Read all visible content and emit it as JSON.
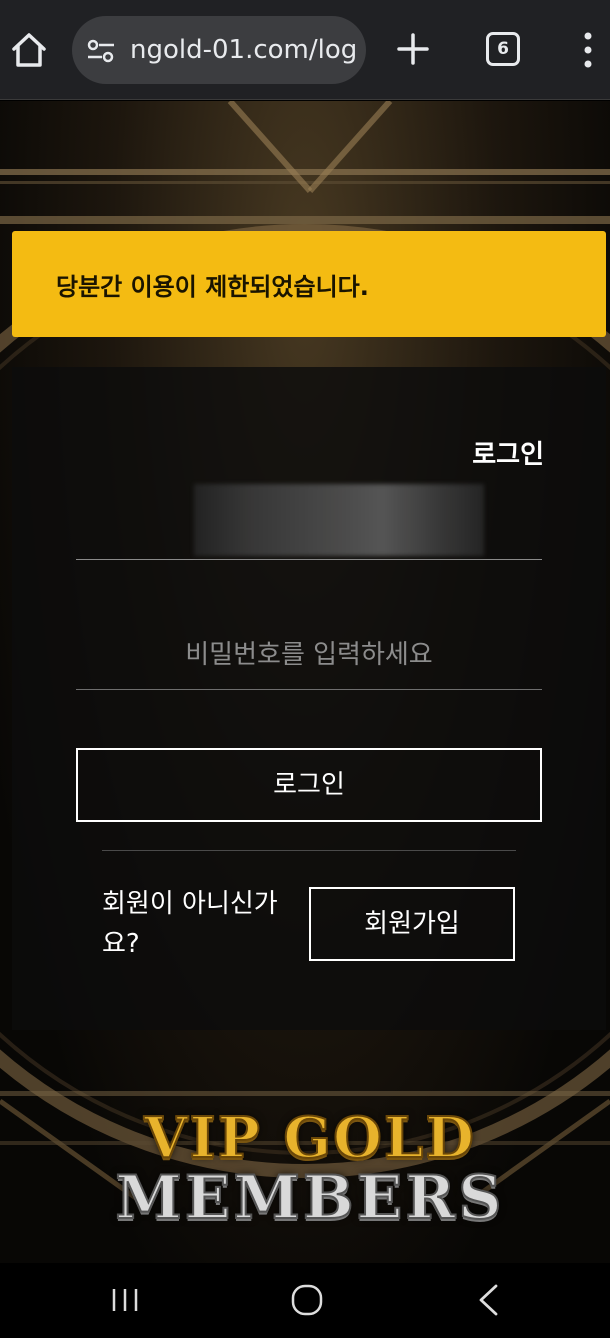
{
  "browser": {
    "url": "ngold-01.com/log",
    "tab_count": "6"
  },
  "alert": {
    "message": "당분간 이용이 제한되었습니다.",
    "color": "#f4bb12"
  },
  "login_panel": {
    "title": "로그인",
    "password_placeholder": "비밀번호를 입력하세요",
    "login_button": "로그인",
    "not_member_text": "회원이 아니신가요?",
    "signup_button": "회원가입"
  },
  "logo": {
    "line1": "VIP GOLD",
    "line2": "MEMBERS"
  },
  "icons": {
    "home": "home-icon",
    "site_settings": "tune-icon",
    "new_tab": "plus-icon",
    "menu": "more-vert-icon",
    "recents": "recents-icon",
    "nav_home": "circle-home-icon",
    "back": "back-icon"
  }
}
